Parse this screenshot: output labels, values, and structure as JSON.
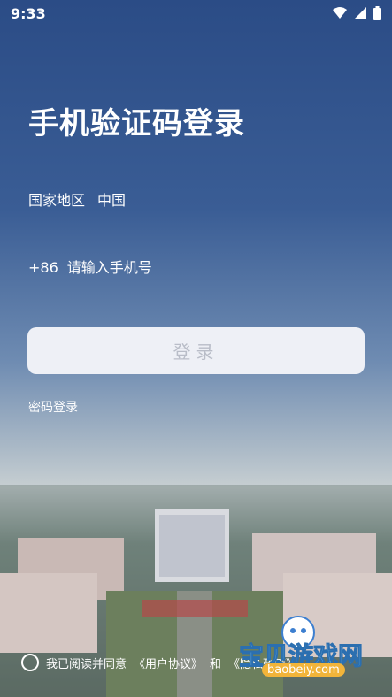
{
  "statusbar": {
    "time": "9:33"
  },
  "title": "手机验证码登录",
  "region": {
    "label": "国家地区",
    "value": "中国"
  },
  "phone": {
    "code": "+86",
    "placeholder": "请输入手机号"
  },
  "login_button": "登录",
  "password_login": "密码登录",
  "agreement": {
    "prefix": "我已阅读并同意",
    "user": "《用户协议》",
    "and": "和",
    "privacy": "《隐私政策》"
  },
  "watermark": {
    "title": "宝贝游戏网",
    "url": "baobeiy.com"
  }
}
